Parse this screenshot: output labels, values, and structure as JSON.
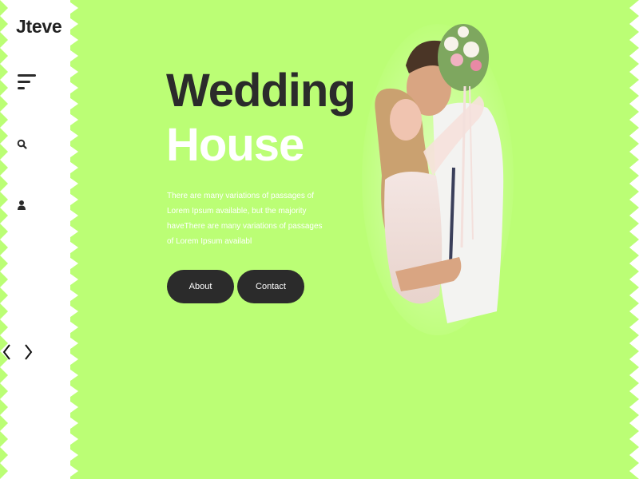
{
  "brand": {
    "name": "Jteve"
  },
  "hero": {
    "title_line1": "Wedding",
    "title_line2": "House",
    "description": "There are many variations of passages of Lorem Ipsum available, but the majority haveThere are many variations of passages of Lorem Ipsum availabl"
  },
  "buttons": {
    "about": "About",
    "contact": "Contact"
  },
  "icons": {
    "menu": "hamburger-menu-icon",
    "search": "search-icon",
    "user": "user-icon",
    "prev": "chevron-left-icon",
    "next": "chevron-right-icon"
  },
  "colors": {
    "background": "#bbfe75",
    "sidebar": "#ffffff",
    "dark": "#2b2b2b",
    "white": "#ffffff"
  }
}
